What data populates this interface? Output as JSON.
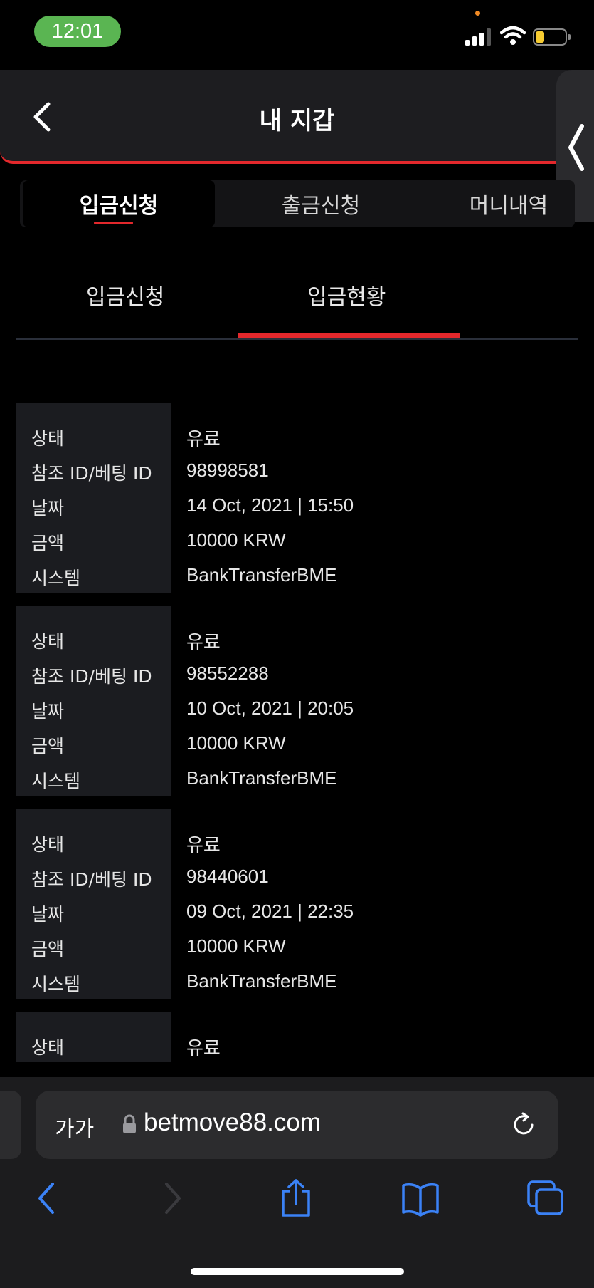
{
  "status_bar": {
    "time": "12:01"
  },
  "header": {
    "title": "내 지갑"
  },
  "main_tabs": [
    {
      "label": "입금신청",
      "active": true
    },
    {
      "label": "출금신청",
      "active": false
    },
    {
      "label": "머니내역",
      "active": false
    }
  ],
  "sub_tabs": [
    {
      "label": "입금신청",
      "active": false
    },
    {
      "label": "입금현황",
      "active": true
    }
  ],
  "labels": {
    "status": "상태",
    "ref_id": "참조 ID/베팅 ID",
    "date": "날짜",
    "amount": "금액",
    "system": "시스템"
  },
  "records": [
    {
      "status": "유료",
      "ref_id": "98998581",
      "date": "14 Oct, 2021 | 15:50",
      "amount": "10000 KRW",
      "system": "BankTransferBME"
    },
    {
      "status": "유료",
      "ref_id": "98552288",
      "date": "10 Oct, 2021 | 20:05",
      "amount": "10000 KRW",
      "system": "BankTransferBME"
    },
    {
      "status": "유료",
      "ref_id": "98440601",
      "date": "09 Oct, 2021 | 22:35",
      "amount": "10000 KRW",
      "system": "BankTransferBME"
    },
    {
      "status": "유료"
    }
  ],
  "browser": {
    "text_size_label": "가가",
    "url": "betmove88.com"
  },
  "colors": {
    "accent": "#e3282c",
    "time_pill": "#5ab552",
    "browser_icons": "#3b82f6"
  },
  "icons": [
    "back-arrow-icon",
    "side-panel-chevron-icon",
    "lock-icon",
    "reload-icon",
    "browser-back-icon",
    "browser-forward-icon",
    "share-icon",
    "bookmarks-icon",
    "tabs-icon"
  ]
}
